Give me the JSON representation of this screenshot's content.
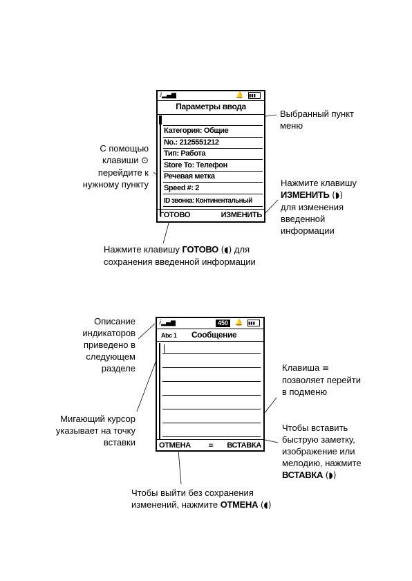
{
  "screen1": {
    "title": "Параметры ввода",
    "items": [
      "Категория: Общие",
      "No.: 2125551212",
      "Тип: Работа",
      "Store To: Телефон",
      "Речевая метка",
      "Speed #: 2",
      "ID звонка: Континентальный"
    ],
    "softkey_left": "ГОТОВО",
    "softkey_right": "ИЗМЕНИТЬ"
  },
  "captions1": {
    "selected_item": "Выбранный пункт\nменю",
    "navigate_pre": "С помощью",
    "navigate_line2": "клавиши",
    "navigate_rest": "перейдите к\nнужному пункту",
    "change_pre": "Нажмите клавишу",
    "change_key": "ИЗМЕНИТЬ",
    "change_post": "для изменения\nвведенной\nинформации",
    "done_pre": "Нажмите клавишу",
    "done_key": "ГОТОВО",
    "done_post": "для",
    "done_line2": "сохранения введенной информации"
  },
  "screen2": {
    "counter": "450",
    "mode": "Abc 1",
    "title": "Сообщение",
    "softkey_left": "ОТМЕНА",
    "softkey_right": "ВСТАВКА"
  },
  "captions2": {
    "indicators": "Описание\nиндикаторов\nприведено в\nследующем\nразделе",
    "cursor": "Мигающий курсор\nуказывает на точку\nвставки",
    "menu_pre": "Клавиша",
    "menu_post": "позволяет перейти\nв подменю",
    "insert": "Чтобы вставить\nбыструю заметку,\nизображение или\nмелодию, нажмите",
    "insert_key": "ВСТАВКА",
    "cancel_pre": "Чтобы выйти без сохранения",
    "cancel_line2": "изменений, нажмите",
    "cancel_key": "ОТМЕНА"
  }
}
